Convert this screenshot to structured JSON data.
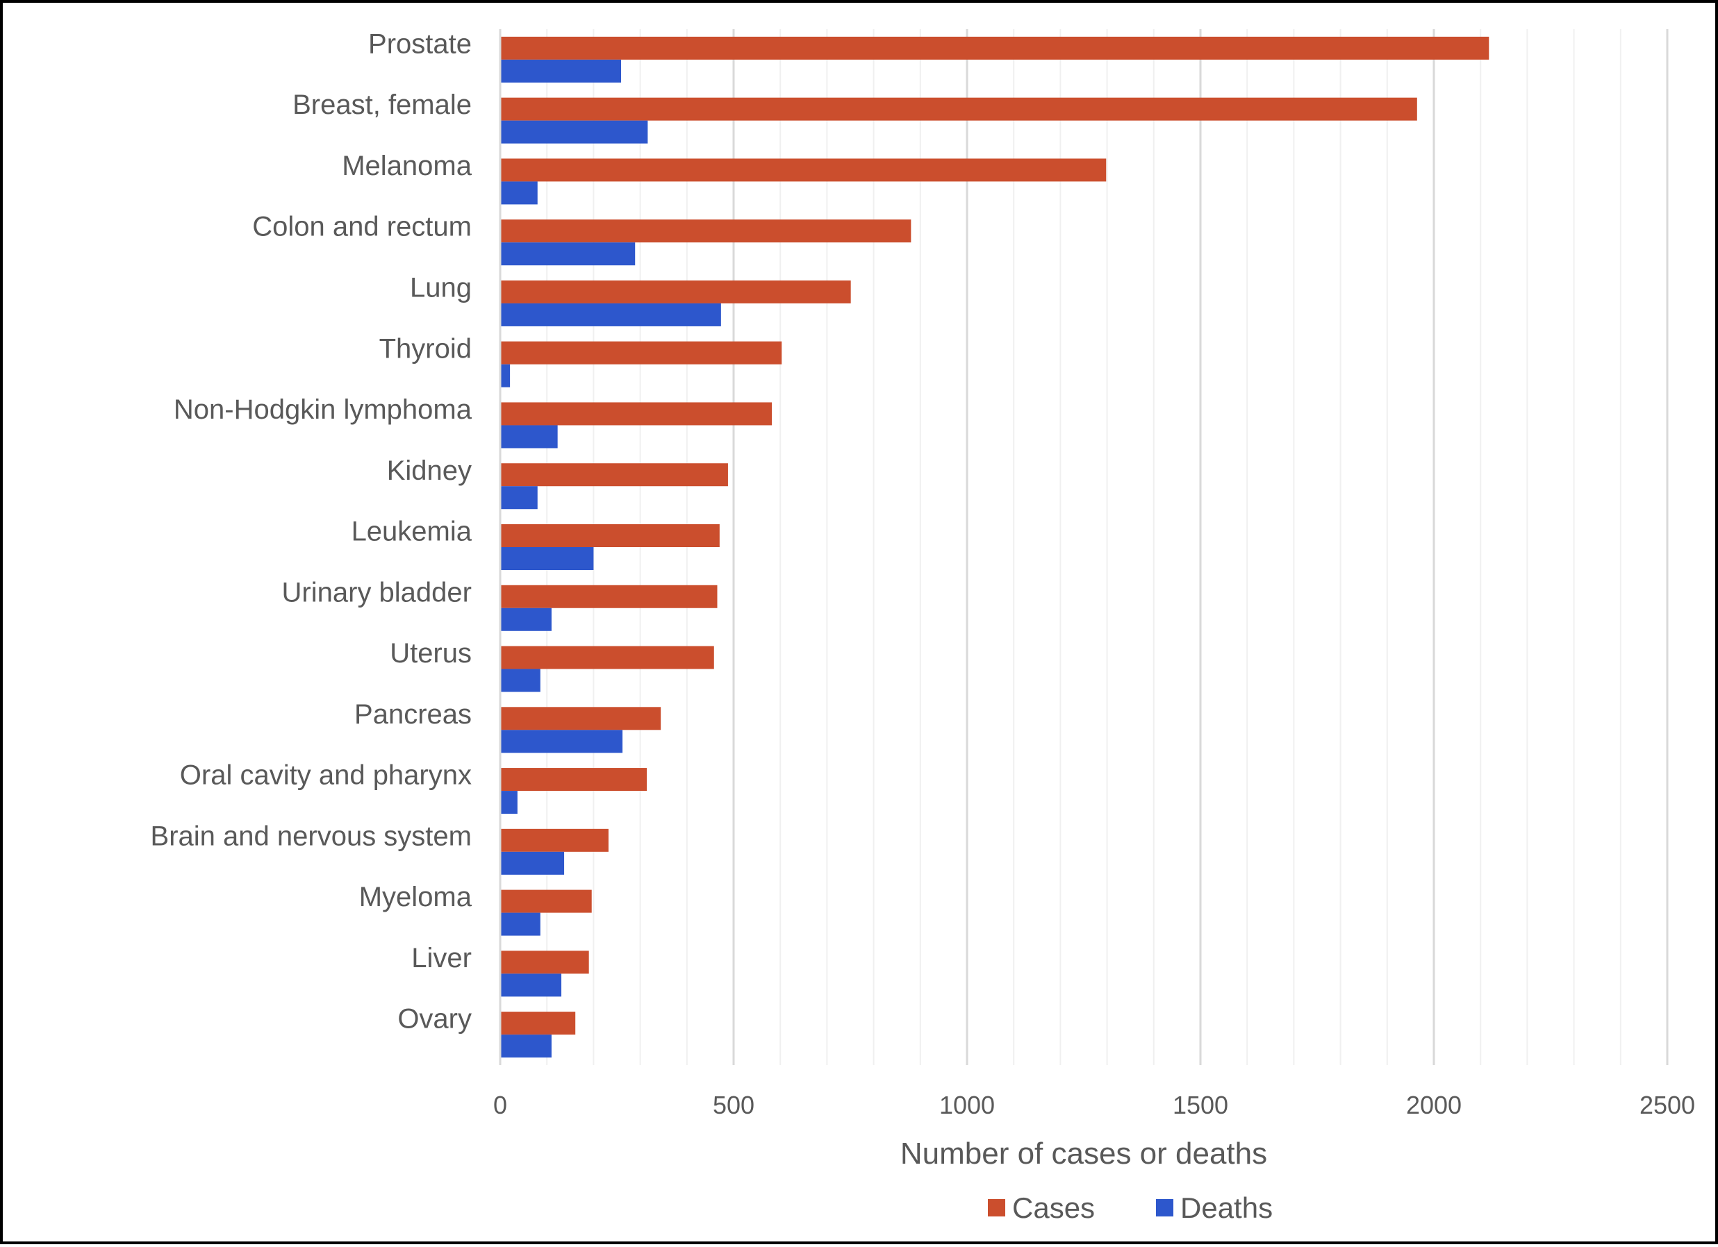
{
  "chart_data": {
    "type": "bar",
    "orientation": "horizontal",
    "title": "",
    "xlabel": "Number of cases or deaths",
    "ylabel": "",
    "xlim": [
      0,
      2500
    ],
    "x_ticks": [
      0,
      500,
      1000,
      1500,
      2000,
      2500
    ],
    "x_tick_labels": [
      "0",
      "500",
      "1000",
      "1500",
      "2000",
      "2500"
    ],
    "minor_gridline_step": 100,
    "grid": true,
    "legend_position": "bottom-right",
    "categories": [
      "Prostate",
      "Breast, female",
      "Melanoma",
      "Colon and rectum",
      "Lung",
      "Thyroid",
      "Non-Hodgkin lymphoma",
      "Kidney",
      "Leukemia",
      "Urinary bladder",
      "Uterus",
      "Pancreas",
      "Oral cavity and pharynx",
      "Brain and nervous system",
      "Myeloma",
      "Liver",
      "Ovary"
    ],
    "series": [
      {
        "name": "Cases",
        "color": "#CB4E2D",
        "values": [
          2118,
          1964,
          1298,
          880,
          751,
          603,
          582,
          488,
          470,
          465,
          458,
          344,
          314,
          232,
          196,
          190,
          161
        ]
      },
      {
        "name": "Deaths",
        "color": "#2D57CC",
        "values": [
          259,
          316,
          80,
          289,
          473,
          21,
          123,
          80,
          200,
          110,
          86,
          262,
          37,
          137,
          86,
          131,
          110
        ]
      }
    ]
  }
}
